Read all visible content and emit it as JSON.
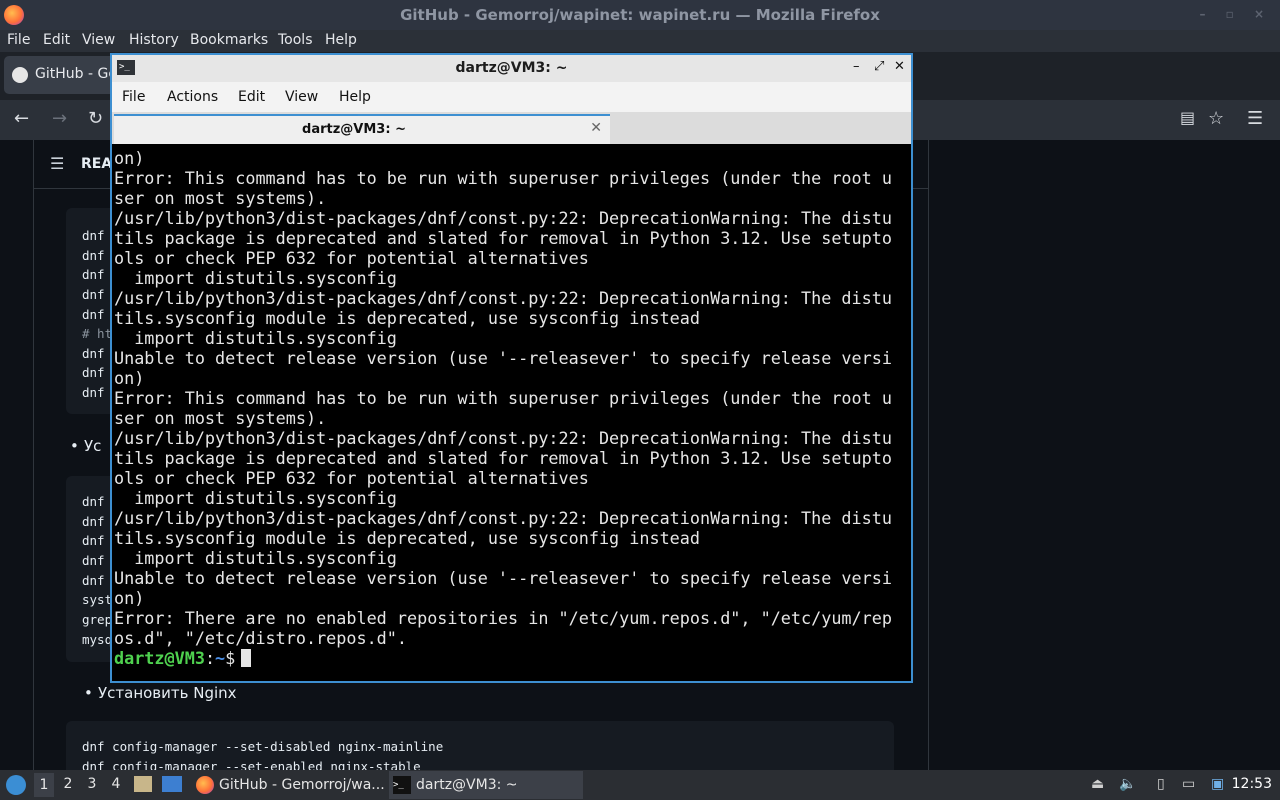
{
  "firefox": {
    "window_title": "GitHub - Gemorroj/wapinet: wapinet.ru — Mozilla Firefox",
    "menu": [
      "File",
      "Edit",
      "View",
      "History",
      "Bookmarks",
      "Tools",
      "Help"
    ],
    "tab_label": "GitHub - Ge",
    "readme_label": "REA",
    "code_block_1": [
      "dnf",
      "dnf",
      "dnf",
      "dnf",
      "dnf",
      "# ht",
      "dnf",
      "dnf",
      "dnf"
    ],
    "bullet_1": "Ус",
    "code_block_2": [
      "dnf",
      "dnf",
      "dnf",
      "dnf",
      "dnf",
      "syst",
      "grep",
      "mysq"
    ],
    "bullet_2": "Установить Nginx",
    "code_block_3": [
      "dnf config-manager --set-disabled nginx-mainline",
      "dnf config-manager --set-enabled nginx-stable"
    ]
  },
  "terminal": {
    "window_title": "dartz@VM3: ~",
    "menu": [
      "File",
      "Actions",
      "Edit",
      "View",
      "Help"
    ],
    "tab_label": "dartz@VM3: ~",
    "output": "on)\nError: This command has to be run with superuser privileges (under the root u\nser on most systems).\n/usr/lib/python3/dist-packages/dnf/const.py:22: DeprecationWarning: The distu\ntils package is deprecated and slated for removal in Python 3.12. Use setupto\nols or check PEP 632 for potential alternatives\n  import distutils.sysconfig\n/usr/lib/python3/dist-packages/dnf/const.py:22: DeprecationWarning: The distu\ntils.sysconfig module is deprecated, use sysconfig instead\n  import distutils.sysconfig\nUnable to detect release version (use '--releasever' to specify release versi\non)\nError: This command has to be run with superuser privileges (under the root u\nser on most systems).\n/usr/lib/python3/dist-packages/dnf/const.py:22: DeprecationWarning: The distu\ntils package is deprecated and slated for removal in Python 3.12. Use setupto\nols or check PEP 632 for potential alternatives\n  import distutils.sysconfig\n/usr/lib/python3/dist-packages/dnf/const.py:22: DeprecationWarning: The distu\ntils.sysconfig module is deprecated, use sysconfig instead\n  import distutils.sysconfig\nUnable to detect release version (use '--releasever' to specify release versi\non)\nError: There are no enabled repositories in \"/etc/yum.repos.d\", \"/etc/yum/rep\nos.d\", \"/etc/distro.repos.d\".",
    "prompt_user": "dartz@VM3",
    "prompt_sep": ":",
    "prompt_path": "~",
    "prompt_symbol": "$"
  },
  "taskbar": {
    "workspaces": [
      "1",
      "2",
      "3",
      "4"
    ],
    "tasks": [
      "GitHub - Gemorroj/wa...",
      "dartz@VM3: ~"
    ],
    "clock": "12:53"
  }
}
